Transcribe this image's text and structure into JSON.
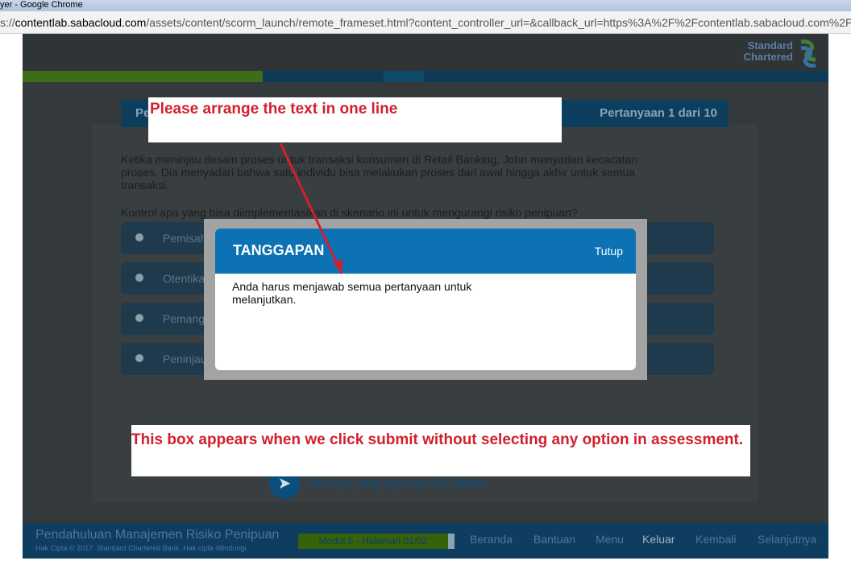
{
  "window": {
    "title": "yer - Google Chrome",
    "url_prefix": "s://",
    "url_host": "contentlab.sabacloud.com",
    "url_rest": "/assets/content/scorm_launch/remote_frameset.html?content_controller_url=&callback_url=https%3A%2F%2Fcontentlab.sabacloud.com%2FS&"
  },
  "brand": {
    "line1": "Standard",
    "line2": "Chartered"
  },
  "stripe_colors": [
    "#3c6e1a",
    "#3c6e1a",
    "#0d3a57",
    "#0f4a6a",
    "#0d3a57"
  ],
  "question": {
    "title_visible": "Pe",
    "counter": "Pertanyaan  1  dari 10",
    "text": "Ketika meninjau desain proses untuk transaksi konsumen di Retail Banking, John menyadari kecacatan proses. Dia menyadari bahwa satu individu bisa melakukan proses dari awal hingga akhir untuk semua transaksi.",
    "prompt": "Kontrol apa yang bisa diimplementasikan di skenario ini untuk mengurangi risiko penipuan?",
    "options": [
      {
        "label": "Pemisah"
      },
      {
        "label": "Otentika"
      },
      {
        "label": "Pemang"
      },
      {
        "label": "Peninjau"
      }
    ],
    "instruction_text": "Pilih opsi yang tepat dan klik ",
    "instruction_bold": "Kirim."
  },
  "modal": {
    "title": "TANGGAPAN",
    "close_label": "Tutup",
    "body": "Anda harus menjawab semua pertanyaan untuk melanjutkan."
  },
  "footer": {
    "course_title": "Pendahuluan Manajemen Risiko Penipuan",
    "copyright": "Hak Cipta © 2017. Standard Chartered Bank. Hak cipta dilindungi.",
    "module": "Modul 5 - Halaman 01/02",
    "nav": {
      "home": "Beranda",
      "help": "Bantuan",
      "menu": "Menu",
      "exit": "Keluar",
      "back": "Kembali",
      "next": "Selanjutnya"
    }
  },
  "annotations": {
    "top": "Please arrange the text in one line",
    "bottom": "This box appears when we click submit without selecting any option in assessment."
  },
  "colors": {
    "modal_header": "#0c72b4",
    "annotation_text": "#d21f2d",
    "footer_bg": "#0f3d5f"
  }
}
